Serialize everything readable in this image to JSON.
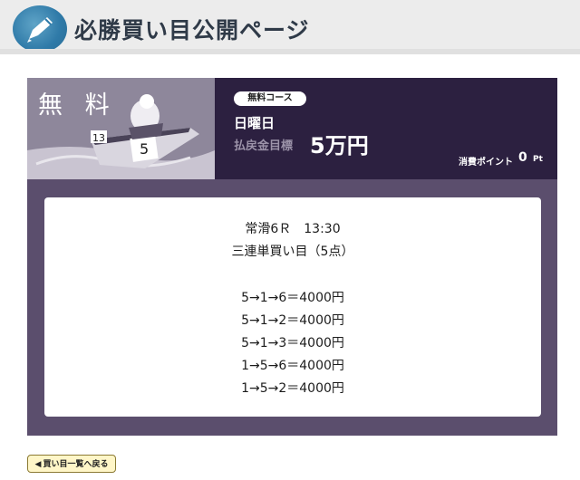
{
  "header": {
    "title": "必勝買い目公開ページ"
  },
  "plan": {
    "thumb_label": "無 料",
    "course_badge": "無料コース",
    "day": "日曜日",
    "target_label": "払戻金目標",
    "target_value": "5万円",
    "points_label": "消費ポイント",
    "points_value": "0",
    "points_unit": "Pt"
  },
  "picks": {
    "race": "常滑6Ｒ　13:30",
    "bet_type": "三連単買い目（5点）",
    "lines": [
      "5→1→6＝4000円",
      "5→1→2＝4000円",
      "5→1→3＝4000円",
      "1→5→6＝4000円",
      "1→5→2＝4000円"
    ]
  },
  "footer": {
    "back_label": "買い目一覧へ戻る"
  }
}
